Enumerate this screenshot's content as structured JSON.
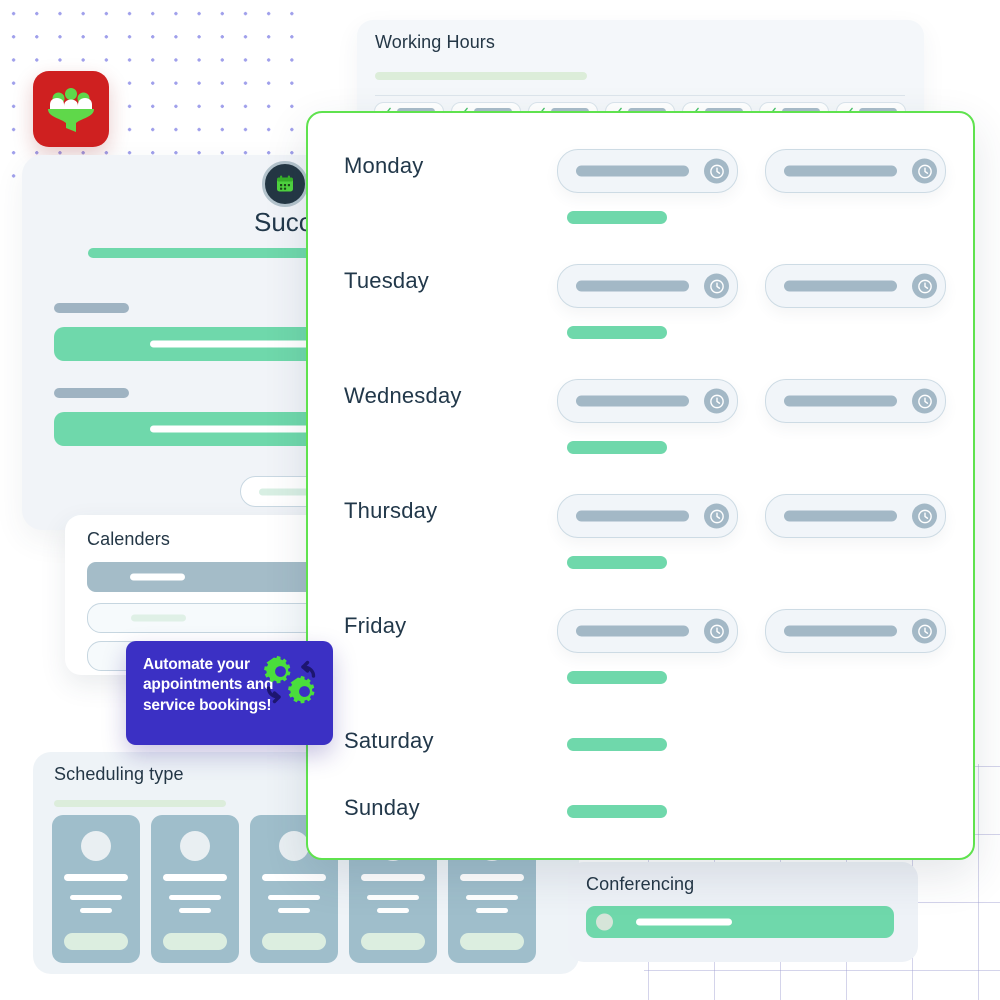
{
  "app": {
    "logo_icon": "people-funnel-icon",
    "accent_green": "#5fe24e",
    "accent_mint": "#6fd8ab",
    "accent_purple": "#3b30c4",
    "logo_background": "#cf2020"
  },
  "working_hours_card": {
    "title": "Working Hours",
    "checkbox_count": 7,
    "check_icon": "checkmark-icon"
  },
  "success_card": {
    "badge_icon": "calendar-icon",
    "title": "Success",
    "field_count": 2
  },
  "calenders_card": {
    "title": "Calenders",
    "row_count": 3
  },
  "promo_badge": {
    "text": "Automate your appointments and service bookings!",
    "icon": "gears-refresh-icon"
  },
  "scheduling_card": {
    "title": "Scheduling type",
    "card_count": 5
  },
  "conferencing_card": {
    "title": "Conferencing",
    "toggle_icon": "toggle-dot-icon"
  },
  "schedule_panel": {
    "clock_icon": "clock-icon",
    "days": [
      {
        "name": "Monday",
        "has_time_fields": true,
        "enabled": true
      },
      {
        "name": "Tuesday",
        "has_time_fields": true,
        "enabled": true
      },
      {
        "name": "Wednesday",
        "has_time_fields": true,
        "enabled": true
      },
      {
        "name": "Thursday",
        "has_time_fields": true,
        "enabled": true
      },
      {
        "name": "Friday",
        "has_time_fields": true,
        "enabled": true
      },
      {
        "name": "Saturday",
        "has_time_fields": false,
        "enabled": false
      },
      {
        "name": "Sunday",
        "has_time_fields": false,
        "enabled": false
      }
    ]
  }
}
